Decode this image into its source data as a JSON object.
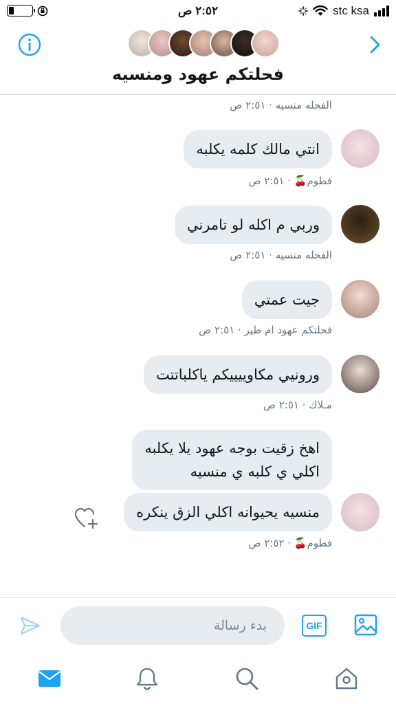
{
  "status_bar": {
    "time": "٢:٥٢ ص",
    "carrier": "stc ksa"
  },
  "header": {
    "title": "فحلتكم عهود ومنسيه"
  },
  "messages": [
    {
      "meta": "الفحله منسيه · ٢:٥١ ص"
    },
    {
      "text": "انتي مالك كلمه يكلبه",
      "meta": "فطوم🍒 · ٢:٥١ ص"
    },
    {
      "text": "وربي م اكله لو تامرني",
      "meta": "الفحله منسيه · ٢:٥١ ص"
    },
    {
      "text": "جيت عمتي",
      "meta": "فحلتكم عهود ام طيز · ٢:٥١ ص"
    },
    {
      "text": "ورونيي مكاوييييكم ياكلباتتت",
      "meta": "مـلاك · ٢:٥١ ص"
    },
    {
      "lines": [
        "اهخ زقيت بوجه عهود يلا يكلبه",
        "اكلي ي كلبه ي منسيه"
      ]
    },
    {
      "text": "منسيه يحيوانه اكلي الزق ينكره",
      "meta": "فطوم🍒 · ٢:٥٢ ص"
    }
  ],
  "composer": {
    "placeholder": "بدء رسالة",
    "gif_label": "GIF"
  },
  "icons": {
    "accent": "#1da1f2",
    "info": "info-icon",
    "back": "chevron-right-icon",
    "heart_add": "heart-plus-icon",
    "send": "send-icon",
    "image": "image-icon",
    "mail": "mail-icon",
    "bell": "bell-icon",
    "search": "search-icon",
    "home": "home-icon"
  }
}
